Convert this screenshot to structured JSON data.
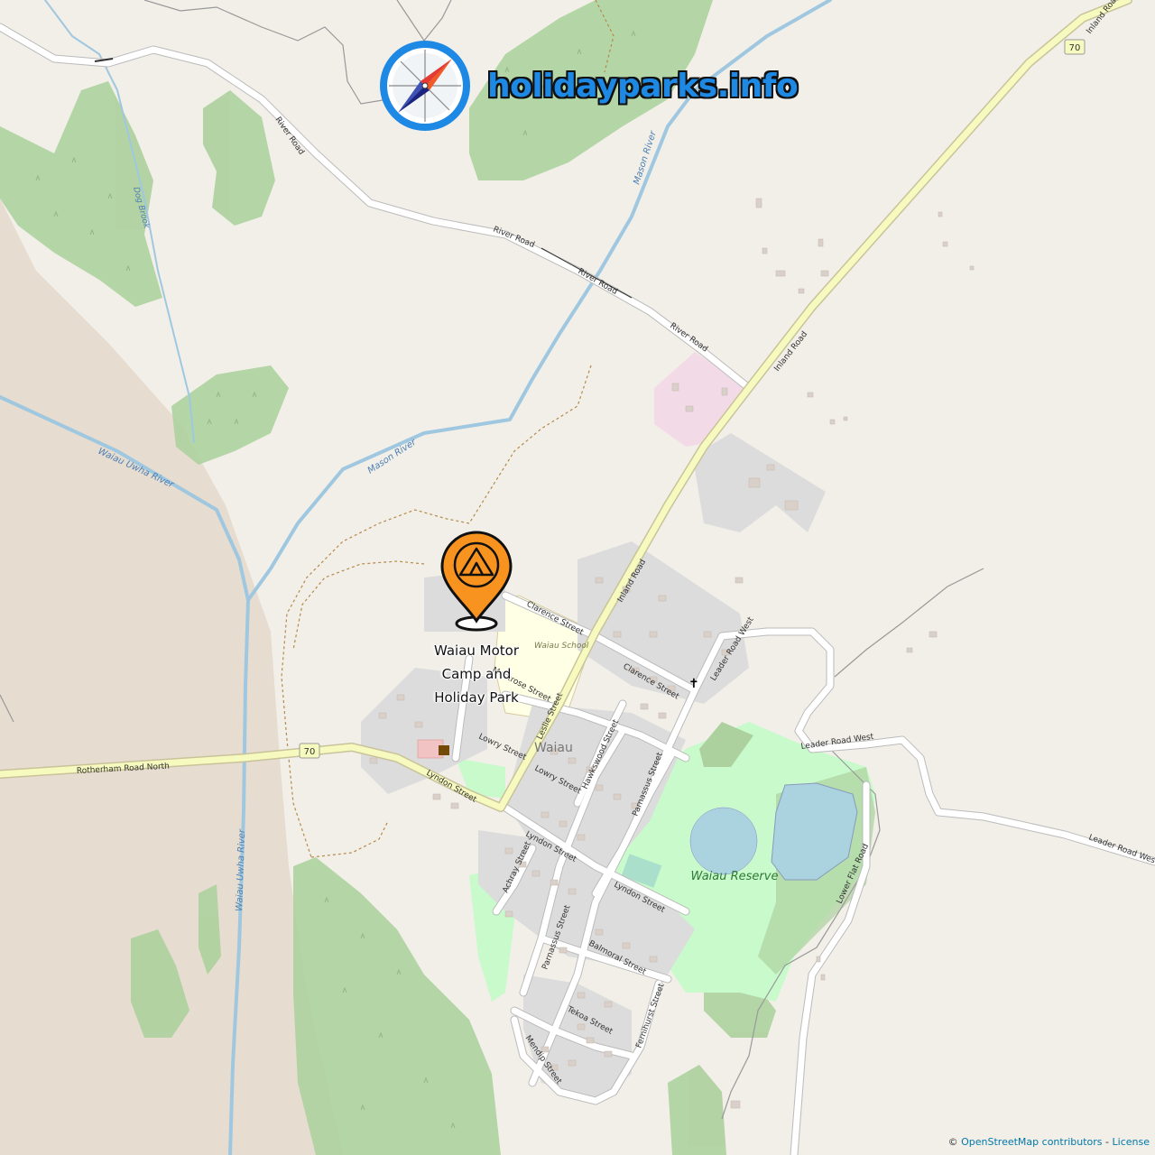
{
  "brand": {
    "text": "holidayparks.info",
    "icon": "compass-icon"
  },
  "marker": {
    "name": "Waiau Motor Camp and Holiday Park",
    "icon": "tent-pin-icon",
    "color": "#f7931e"
  },
  "roads": {
    "river_road_1": "River Road",
    "river_road_2": "River Road",
    "river_road_3": "River Road",
    "river_road_4": "River Road",
    "inland_road_1": "Inland Road",
    "inland_road_2": "Inland Road",
    "inland_road_3": "Inland Road",
    "rotherham": "Rotherham Road North",
    "lyndon_1": "Lyndon Street",
    "lyndon_2": "Lyndon Street",
    "lyndon_3": "Lyndon Street",
    "clarence_1": "Clarence Street",
    "clarence_2": "Clarence Street",
    "leslie": "Leslie Street",
    "montrose": "Montrose Street",
    "lowry_1": "Lowry Street",
    "lowry_2": "Lowry Street",
    "hawkswood": "Hawkswood Street",
    "parnassus_1": "Parnassus Street",
    "parnassus_2": "Parnassus Street",
    "achray": "Achray Street",
    "balmoral": "Balmoral Street",
    "tekoa": "Tekoa Street",
    "fernihurst": "Fernihurst Street",
    "mendip": "Mendip Street",
    "leader_west_1": "Leader Road West",
    "leader_west_2": "Leader Road West",
    "leader_west_3": "Leader Road West",
    "lower_flat": "Lower Flat Road",
    "route_70_a": "70",
    "route_70_b": "70"
  },
  "water": {
    "mason_1": "Mason River",
    "mason_2": "Mason River",
    "waiau_uwha_1": "Waiau Uwha River",
    "waiau_uwha_2": "Waiau Uwha River",
    "dog_brook": "Dog Brook"
  },
  "places": {
    "town": "Waiau",
    "school": "Waiau School",
    "reserve": "Waiau Reserve"
  },
  "attribution": {
    "prefix": "©",
    "osm": "OpenStreetMap contributors",
    "sep": "-",
    "license": "License"
  },
  "colors": {
    "land": "#f2efe9",
    "wood": "#add19e",
    "park": "#c8facc",
    "water": "#aad3df",
    "river": "#9fc8e0",
    "main_road": "#f7fabf",
    "road_casing": "#c9c39a",
    "school": "#ffffe5",
    "riverbed": "#e6dccf"
  }
}
